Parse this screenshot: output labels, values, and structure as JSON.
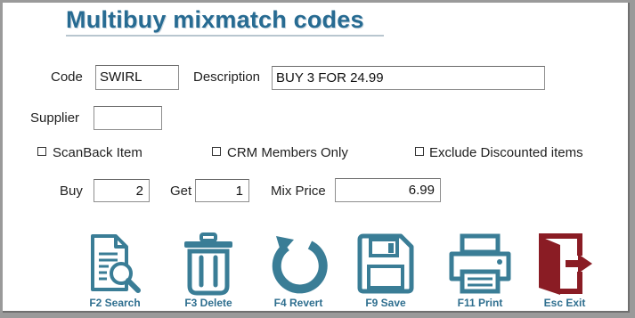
{
  "title": "Multibuy mixmatch codes",
  "fields": {
    "code_label": "Code",
    "code_value": "SWIRL",
    "description_label": "Description",
    "description_value": "BUY 3 FOR 24.99",
    "supplier_label": "Supplier",
    "supplier_value": ""
  },
  "checkboxes": [
    {
      "label": "ScanBack Item",
      "checked": false
    },
    {
      "label": "CRM Members Only",
      "checked": false
    },
    {
      "label": "Exclude Discounted items",
      "checked": false
    }
  ],
  "pricing": {
    "buy_label": "Buy",
    "buy_value": "2",
    "get_label": "Get",
    "get_value": "1",
    "mix_price_label": "Mix Price",
    "mix_price_value": "6.99"
  },
  "actions": [
    {
      "label": "F2 Search",
      "icon": "search-document-icon"
    },
    {
      "label": "F3 Delete",
      "icon": "trash-icon"
    },
    {
      "label": "F4 Revert",
      "icon": "revert-icon"
    },
    {
      "label": "F9 Save",
      "icon": "floppy-disk-icon"
    },
    {
      "label": "F11 Print",
      "icon": "printer-icon"
    },
    {
      "label": "Esc Exit",
      "icon": "exit-door-icon"
    }
  ],
  "colors": {
    "accent": "#276b92",
    "icon_teal": "#3a7d96",
    "exit_red": "#8a1c24",
    "caption": "#2f6f8f"
  }
}
